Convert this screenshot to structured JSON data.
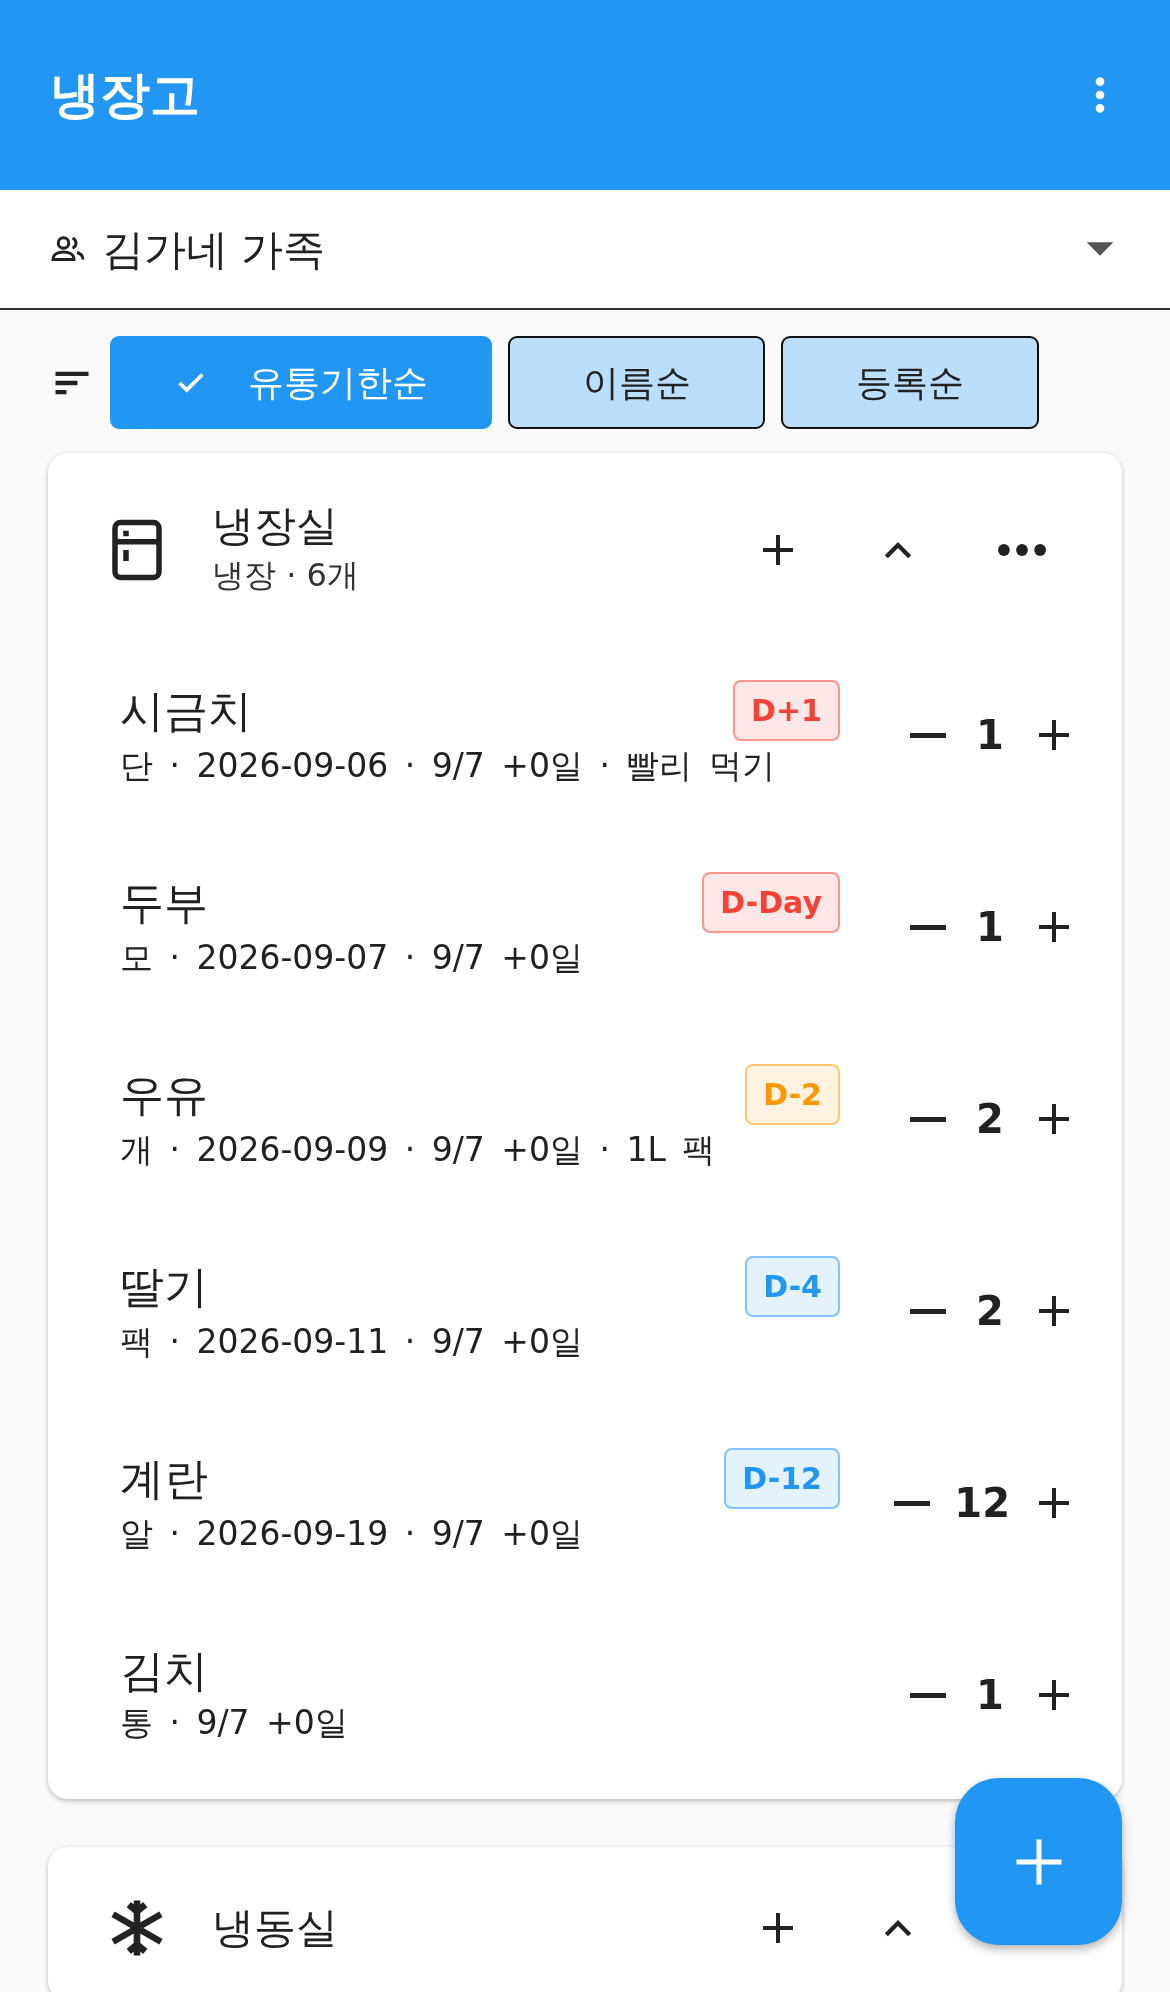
{
  "app_bar": {
    "title": "냉장고"
  },
  "family_selector": {
    "value": "김가네 가족"
  },
  "sort_chips": [
    {
      "label": "유통기한순",
      "selected": true
    },
    {
      "label": "이름순",
      "selected": false
    },
    {
      "label": "등록순",
      "selected": false
    }
  ],
  "sections": [
    {
      "kind": "fridge",
      "title": "냉장실",
      "subtitle": "냉장 · 6개",
      "expanded": true,
      "items": [
        {
          "name": "시금치",
          "meta": "단 · 2026-09-06 · 9/7 +0일 · 빨리 먹기",
          "badge": {
            "label": "D+1",
            "color": "#f44336"
          },
          "quantity": "1"
        },
        {
          "name": "두부",
          "meta": "모 · 2026-09-07 · 9/7 +0일",
          "badge": {
            "label": "D-Day",
            "color": "#f44336"
          },
          "quantity": "1"
        },
        {
          "name": "우유",
          "meta": "개 · 2026-09-09 · 9/7 +0일 · 1L 팩",
          "badge": {
            "label": "D-2",
            "color": "#ff9800"
          },
          "quantity": "2"
        },
        {
          "name": "딸기",
          "meta": "팩 · 2026-09-11 · 9/7 +0일",
          "badge": {
            "label": "D-4",
            "color": "#2196f3"
          },
          "quantity": "2"
        },
        {
          "name": "계란",
          "meta": "알 · 2026-09-19 · 9/7 +0일",
          "badge": {
            "label": "D-12",
            "color": "#2196f3"
          },
          "quantity": "12"
        },
        {
          "name": "김치",
          "meta": "통 · 9/7 +0일",
          "quantity": "1"
        }
      ]
    },
    {
      "kind": "freezer",
      "title": "냉동실",
      "expanded": true
    }
  ]
}
